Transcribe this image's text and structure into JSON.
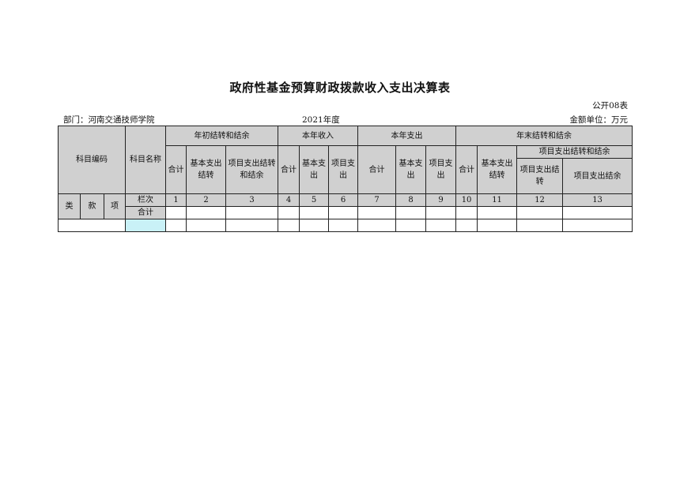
{
  "title": "政府性基金预算财政拨款收入支出决算表",
  "form_no": "公开08表",
  "department": "部门：河南交通技师学院",
  "year": "2021年度",
  "unit": "金额单位：万元",
  "table": {
    "subject_code": "科目编码",
    "subject_name": "科目名称",
    "group_begin": "年初结转和结余",
    "group_income": "本年收入",
    "group_expense": "本年支出",
    "group_end": "年末结转和结余",
    "group_end_project": "项目支出结转和结余",
    "col_total": "合计",
    "col_basic": "基本支出结转",
    "col_project": "项目支出结转和结余",
    "col_basic_exp": "基本支出",
    "col_project_exp": "项目支出",
    "col_project_carry": "项目支出结转",
    "col_project_balance": "项目支出结余",
    "code_lei": "类",
    "code_kuan": "款",
    "code_xiang": "项",
    "row_number_label": "栏次",
    "column_numbers": [
      "1",
      "2",
      "3",
      "4",
      "5",
      "6",
      "7",
      "8",
      "9",
      "10",
      "11",
      "12",
      "13"
    ],
    "sum_label": "合计"
  }
}
